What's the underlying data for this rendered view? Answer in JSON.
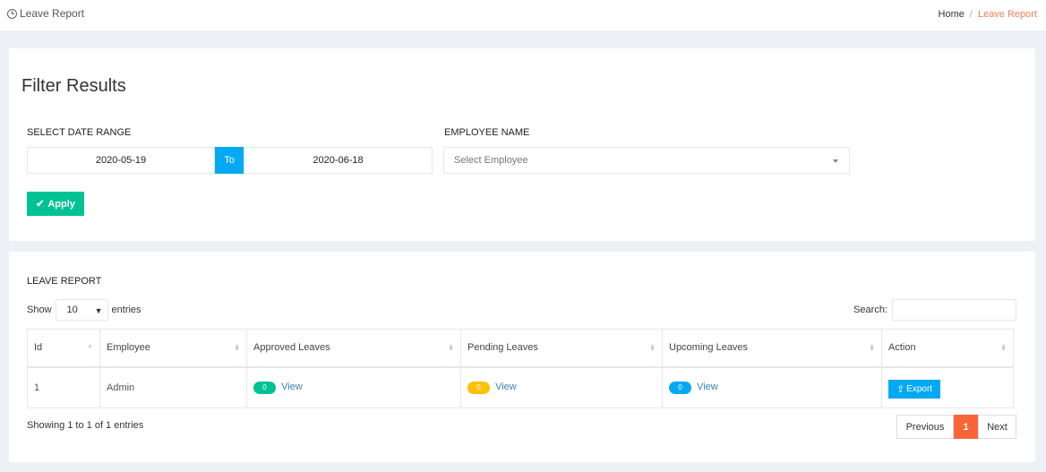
{
  "header": {
    "page_title": "Leave Report",
    "breadcrumb": {
      "home": "Home",
      "separator": "/",
      "current": "Leave Report"
    }
  },
  "filter": {
    "title": "Filter Results",
    "date_range_label": "SELECT DATE RANGE",
    "date_from": "2020-05-19",
    "to_label": "To",
    "date_to": "2020-06-18",
    "employee_label": "EMPLOYEE NAME",
    "employee_placeholder": "Select Employee",
    "apply_label": "Apply"
  },
  "report": {
    "title": "LEAVE REPORT",
    "show_label": "Show",
    "entries_count": "10",
    "entries_label": "entries",
    "search_label": "Search:",
    "columns": [
      "Id",
      "Employee",
      "Approved Leaves",
      "Pending Leaves",
      "Upcoming Leaves",
      "Action"
    ],
    "rows": [
      {
        "id": "1",
        "employee": "Admin",
        "approved_count": "0",
        "pending_count": "0",
        "upcoming_count": "0",
        "view_label": "View",
        "export_label": "Export"
      }
    ],
    "info": "Showing 1 to 1 of 1 entries",
    "pagination": {
      "previous": "Previous",
      "current": "1",
      "next": "Next"
    }
  },
  "colors": {
    "accent_blue": "#03a9f3",
    "success_green": "#00c292",
    "warning_yellow": "#fec107",
    "active_page": "#f9653a",
    "breadcrumb_active": "#f47f5b"
  }
}
